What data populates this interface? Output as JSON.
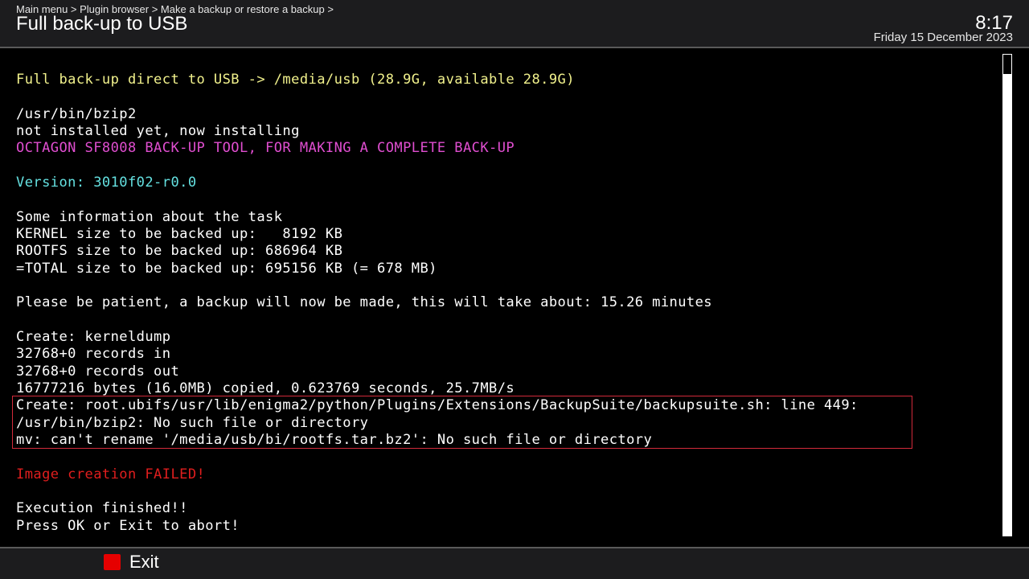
{
  "header": {
    "breadcrumb": "Main menu > Plugin browser > Make a backup or restore a backup >",
    "title": "Full back-up to USB",
    "time": "8:17",
    "date": "Friday 15 December 2023"
  },
  "console": {
    "lines": [
      {
        "text": "Full back-up direct to USB -> /media/usb (28.9G, available 28.9G)",
        "color": "#f1f18c"
      },
      {
        "text": "",
        "color": "#ffffff"
      },
      {
        "text": "/usr/bin/bzip2",
        "color": "#ffffff"
      },
      {
        "text": "not installed yet, now installing",
        "color": "#ffffff"
      },
      {
        "text": "OCTAGON SF8008 BACK-UP TOOL, FOR MAKING A COMPLETE BACK-UP",
        "color": "#e04ed0"
      },
      {
        "text": "",
        "color": "#ffffff"
      },
      {
        "text": "Version: 3010f02-r0.0",
        "color": "#64e0e0"
      },
      {
        "text": "",
        "color": "#ffffff"
      },
      {
        "text": "Some information about the task",
        "color": "#ffffff"
      },
      {
        "text": "KERNEL size to be backed up:   8192 KB",
        "color": "#ffffff"
      },
      {
        "text": "ROOTFS size to be backed up: 686964 KB",
        "color": "#ffffff"
      },
      {
        "text": "=TOTAL size to be backed up: 695156 KB (= 678 MB)",
        "color": "#ffffff"
      },
      {
        "text": "",
        "color": "#ffffff"
      },
      {
        "text": "Please be patient, a backup will now be made, this will take about: 15.26 minutes",
        "color": "#ffffff"
      },
      {
        "text": "",
        "color": "#ffffff"
      },
      {
        "text": "Create: kerneldump",
        "color": "#ffffff"
      },
      {
        "text": "32768+0 records in",
        "color": "#ffffff"
      },
      {
        "text": "32768+0 records out",
        "color": "#ffffff"
      },
      {
        "text": "16777216 bytes (16.0MB) copied, 0.623769 seconds, 25.7MB/s",
        "color": "#ffffff"
      },
      {
        "text": "Create: root.ubifs/usr/lib/enigma2/python/Plugins/Extensions/BackupSuite/backupsuite.sh: line 449:",
        "color": "#ffffff"
      },
      {
        "text": "/usr/bin/bzip2: No such file or directory",
        "color": "#ffffff"
      },
      {
        "text": "mv: can't rename '/media/usb/bi/rootfs.tar.bz2': No such file or directory",
        "color": "#ffffff"
      },
      {
        "text": "",
        "color": "#ffffff"
      },
      {
        "text": "Image creation FAILED!",
        "color": "#e01e1e"
      },
      {
        "text": "",
        "color": "#ffffff"
      },
      {
        "text": "Execution finished!!",
        "color": "#ffffff"
      },
      {
        "text": "Press OK or Exit to abort!",
        "color": "#ffffff"
      }
    ]
  },
  "footer": {
    "exit_label": "Exit",
    "exit_key_color": "#e60000"
  }
}
